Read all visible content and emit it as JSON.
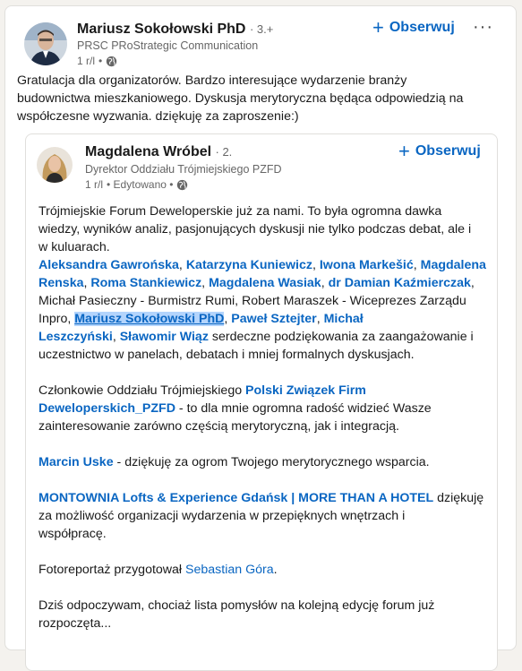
{
  "outer": {
    "name": "Mariusz Sokołowski PhD",
    "degree": "· 3.+",
    "headline": "PRSC PRoStrategic Communication",
    "time": "1 r/l",
    "dot": "•",
    "follow": "Obserwuj",
    "more": "···",
    "text_lines": [
      "Gratulacja dla organizatorów. Bardzo interesujące wydarzenie branży",
      "budownictwa mieszkaniowego. Dyskusja merytoryczna będąca odpowiedzią na",
      "współczesne wyzwania. dziękuję za zaproszenie:)"
    ]
  },
  "inner": {
    "name": "Magdalena Wróbel",
    "degree": "· 2.",
    "headline": "Dyrektor Oddziału Trójmiejskiego PZFD",
    "time": "1 r/l",
    "edited": "• Edytowano •",
    "follow": "Obserwuj",
    "p1": [
      "Trójmiejskie Forum Deweloperskie już za nami. To była ogromna dawka",
      "wiedzy, wyników analiz, pasjonujących dyskusji nie tylko podczas debat, ale i",
      "w kuluarach."
    ],
    "mentions": {
      "m1": "Aleksandra Gawrońska",
      "m2": "Katarzyna Kuniewicz",
      "m3": "Iwona Markešić",
      "m4": "Magdalena",
      "m4b": "Renska",
      "m5": "Roma Stankiewicz",
      "m6": "Magdalena Wasiak",
      "m7": "dr Damian Kaźmierczak",
      "m8": "Mariusz Sokołowski PhD",
      "m9": "Paweł Sztejter",
      "m10": "Michał",
      "m10b": "Leszczyński",
      "m11": "Sławomir Wiąz",
      "m12": "Polski Związek Firm",
      "m12b": "Deweloperskich_PZFD",
      "m13": "Marcin Uske",
      "m14": "MONTOWNIA Lofts & Experience Gdańsk | MORE THAN A HOTEL",
      "m15": "Sebastian Góra"
    },
    "t": {
      "comma": ",",
      "comma_sp": ", ",
      "line3": "Michał Pasieczny - Burmistrz Rumi, Robert Maraszek - Wiceprezes Zarządu",
      "inpro": "Inpro, ",
      "after_wiaz": " serdeczne podziękowania za zaangażowanie i",
      "line_uczest": "uczestnictwo w panelach, debatach i mniej formalnych dyskusjach.",
      "czlonkowie": "Członkowie Oddziału Trójmiejskiego ",
      "after_pzfd": " - to dla mnie ogromna radość widzieć Wasze",
      "line_zaint": "zainteresowanie zarówno częścią merytoryczną, jak i integracją.",
      "after_uske": " - dziękuję za ogrom Twojego merytorycznego wsparcia.",
      "after_montownia": " dziękuję",
      "line_mozl": "za możliwość organizacji wydarzenia w przepięknych wnętrzach i",
      "line_wspol": "współpracę.",
      "foto": "Fotoreportaż przygotował ",
      "dot_end": ".",
      "dzis1": "Dziś odpoczywam, chociaż lista pomysłów na kolejną edycję forum już",
      "dzis2": "rozpoczęta..."
    }
  },
  "colors": {
    "link": "#0a66c2",
    "muted": "#666666",
    "highlight": "#b3d4fc"
  }
}
